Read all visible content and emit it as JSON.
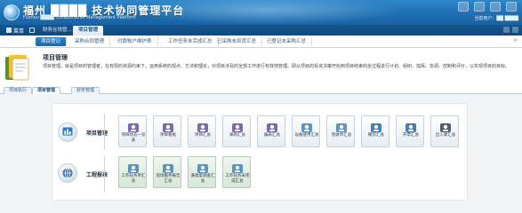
{
  "header": {
    "title": "福州 ████ 技术协同管理平台",
    "subtitle": "Fuzhou ████ Collaborative Management Platform",
    "user_info": "当前用户：██ ████"
  },
  "nav": {
    "menu_label": "菜单",
    "tabs": [
      "财务在线管...",
      "项目管理"
    ]
  },
  "subtabs": [
    "项目登记",
    "采购合同管理",
    "付款账户维护表",
    "工作任务未完成汇总",
    "已采购未到货汇总",
    "已登记未采购汇总"
  ],
  "intro": {
    "title": "项目管理",
    "text": "项目管理，就是项目的管理者，在有限的资源约束下，运用系统的观点、方法和理论，对项目涉及的全部工作进行有效地管理。即从项目的投资决策开始到项目结束的全过程进行计划、组织、指挥、协调、控制和评价，以实现项目的目标。"
  },
  "module_tabs": [
    "项目执行",
    "项目管理",
    "财务管理"
  ],
  "sections": [
    {
      "label": "项目管理",
      "icon": "chart-board-icon",
      "tiles": [
        {
          "label": "项目状态一览表",
          "icon": "people-icon",
          "color": "#6a5aa8"
        },
        {
          "label": "项目看板",
          "icon": "team-icon",
          "color": "#6a5aa8"
        },
        {
          "label": "项目汇总",
          "icon": "person-folder-icon",
          "color": "#6a5aa8"
        },
        {
          "label": "采购汇总",
          "icon": "document-icon",
          "color": "#6a5aa8"
        },
        {
          "label": "编表汇总",
          "icon": "handshake-icon",
          "color": "#6a5aa8"
        },
        {
          "label": "设备使用汇总",
          "icon": "chart-icon",
          "color": "#4a86c2"
        },
        {
          "label": "签收单汇总",
          "icon": "clipboard-icon",
          "color": "#4a86c2"
        },
        {
          "label": "撤货汇总",
          "icon": "puzzle-icon",
          "color": "#2f6fb0"
        },
        {
          "label": "开票汇总",
          "icon": "pin-icon",
          "color": "#2f6fb0"
        },
        {
          "label": "出入库汇总",
          "icon": "clock-icon",
          "color": "#3a4f63"
        }
      ]
    },
    {
      "label": "工程报表",
      "icon": "globe-report-icon",
      "tiles": [
        {
          "label": "工作任务单汇总",
          "icon": "task-icon",
          "color": "#4a86c2"
        },
        {
          "label": "现场服务报告汇总",
          "icon": "report-icon",
          "color": "#4a86c2"
        },
        {
          "label": "满意度调查汇总",
          "icon": "survey-icon",
          "color": "#4a86c2"
        },
        {
          "label": "工作任务未完成汇总",
          "icon": "todo-icon",
          "color": "#4a86c2"
        }
      ]
    }
  ],
  "colors": {
    "header_blue": "#1f6fb3",
    "nav_dark": "#13558f",
    "tile_green": "#d6e7d8"
  }
}
